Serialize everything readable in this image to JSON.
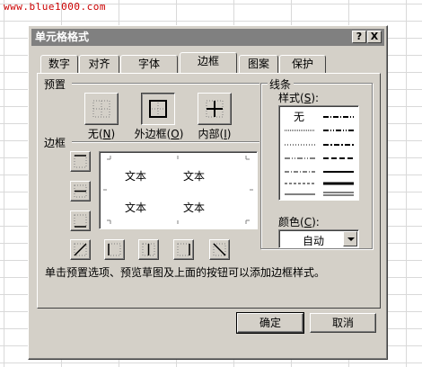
{
  "watermark": "www.blue1000.com",
  "dialog": {
    "title": "单元格格式",
    "help_label": "?",
    "close_label": "X"
  },
  "tabs": [
    {
      "label": "数字",
      "active": false
    },
    {
      "label": "对齐",
      "active": false
    },
    {
      "label": "字体",
      "active": false
    },
    {
      "label": "边框",
      "active": true
    },
    {
      "label": "图案",
      "active": false
    },
    {
      "label": "保护",
      "active": false
    }
  ],
  "presets": {
    "group_label": "预置",
    "none": {
      "label": "无",
      "key": "N"
    },
    "outline": {
      "label": "外边框",
      "key": "O"
    },
    "inside": {
      "label": "内部",
      "key": "I"
    }
  },
  "border_section": {
    "group_label": "边框"
  },
  "preview": {
    "cells": [
      "文本",
      "文本",
      "文本",
      "文本"
    ]
  },
  "line": {
    "group_label": "线条",
    "style_label": "样式",
    "style_key": "S",
    "none_style": "无",
    "color_label": "颜色",
    "color_key": "C",
    "color_value": "自动"
  },
  "hint": "单击预置选项、预览草图及上面的按钮可以添加边框样式。",
  "buttons": {
    "ok": "确定",
    "cancel": "取消"
  }
}
